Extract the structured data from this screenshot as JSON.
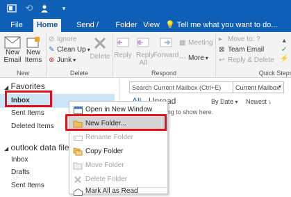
{
  "title_bar": {
    "text": "Tell me what you want to do..."
  },
  "tabs": [
    {
      "label": "File"
    },
    {
      "label": "Home"
    },
    {
      "label": "Send / Receive"
    },
    {
      "label": "Folder"
    },
    {
      "label": "View"
    }
  ],
  "ribbon": {
    "new_email": "New Email",
    "new_items": "New Items",
    "ignore": "Ignore",
    "clean_up": "Clean Up",
    "junk": "Junk",
    "delete": "Delete",
    "reply": "Reply",
    "reply_all": "Reply All",
    "forward": "Forward",
    "meeting": "Meeting",
    "more": "More",
    "move_to": "Move to: ?",
    "team_email": "Team Email",
    "reply_delete": "Reply & Delete",
    "group_new": "New",
    "group_delete": "Delete",
    "group_respond": "Respond",
    "group_quick_steps": "Quick Steps"
  },
  "nav": {
    "favorites": "Favorites",
    "inbox": "Inbox",
    "sent_items": "Sent Items",
    "deleted_items": "Deleted Items",
    "data_file": "outlook data file",
    "inbox2": "Inbox",
    "drafts": "Drafts",
    "sent_items2": "Sent Items"
  },
  "main": {
    "search_placeholder": "Search Current Mailbox (Ctrl+E)",
    "scope": "Current Mailbox",
    "filter_all": "All",
    "filter_unread": "Unread",
    "by_date": "By Date",
    "newest": "Newest",
    "empty_message": "didn't find anything to show here."
  },
  "context_menu": [
    {
      "label": "Open in New Window",
      "icon": "open-window-icon",
      "enabled": true,
      "highlighted": false
    },
    {
      "label": "New Folder...",
      "icon": "new-folder-icon",
      "enabled": true,
      "highlighted": true
    },
    {
      "label": "Rename Folder",
      "icon": "rename-icon",
      "enabled": false,
      "highlighted": false
    },
    {
      "label": "Copy Folder",
      "icon": "copy-folder-icon",
      "enabled": true,
      "highlighted": false
    },
    {
      "label": "Move Folder",
      "icon": "move-folder-icon",
      "enabled": false,
      "highlighted": false
    },
    {
      "label": "Delete Folder",
      "icon": "delete-folder-icon",
      "enabled": false,
      "highlighted": false
    },
    {
      "label": "Mark All as Read",
      "icon": "mark-read-icon",
      "enabled": true,
      "highlighted": false
    }
  ],
  "colors": {
    "accent": "#0e5fb5",
    "highlight_box": "#e0111a"
  }
}
